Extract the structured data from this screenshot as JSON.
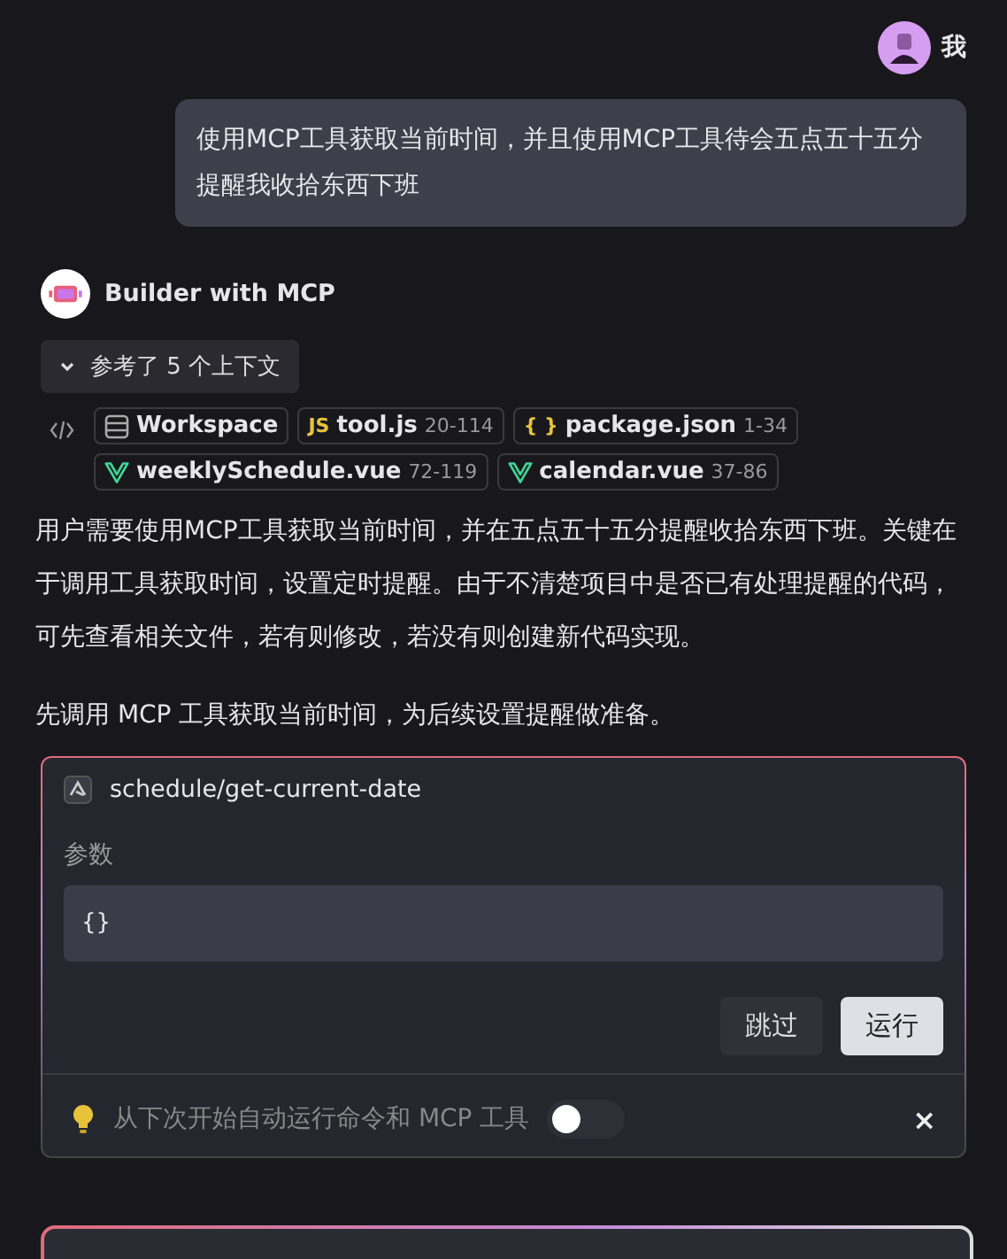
{
  "user": {
    "name": "我",
    "message": "使用MCP工具获取当前时间，并且使用MCP工具待会五点五十五分提醒我收拾东西下班"
  },
  "assistant": {
    "name": "Builder with MCP",
    "context": {
      "label": "参考了 5 个上下文",
      "expanded": true,
      "chips": [
        {
          "kind": "folder",
          "name": "Workspace"
        },
        {
          "kind": "js",
          "icon": "JS",
          "name": "tool.js",
          "range": "20-114"
        },
        {
          "kind": "json",
          "icon": "{ }",
          "name": "package.json",
          "range": "1-34"
        },
        {
          "kind": "vue",
          "name": "weeklySchedule.vue",
          "range": "72-119"
        },
        {
          "kind": "vue",
          "name": "calendar.vue",
          "range": "37-86"
        }
      ]
    },
    "paragraphs": [
      "用户需要使用MCP工具获取当前时间，并在五点五十五分提醒收拾东西下班。关键在于调用工具获取时间，设置定时提醒。由于不清楚项目中是否已有处理提醒的代码，可先查看相关文件，若有则修改，若没有则创建新代码实现。",
      "先调用 MCP 工具获取当前时间，为后续设置提醒做准备。"
    ]
  },
  "tool_call": {
    "name": "schedule/get-current-date",
    "params_label": "参数",
    "params": "{}",
    "buttons": [
      {
        "label": "跳过",
        "kind": "secondary"
      },
      {
        "label": "运行",
        "kind": "primary"
      }
    ],
    "auto_run": {
      "text": "从下次开始自动运行命令和 MCP 工具",
      "on": false,
      "close": "×"
    }
  }
}
